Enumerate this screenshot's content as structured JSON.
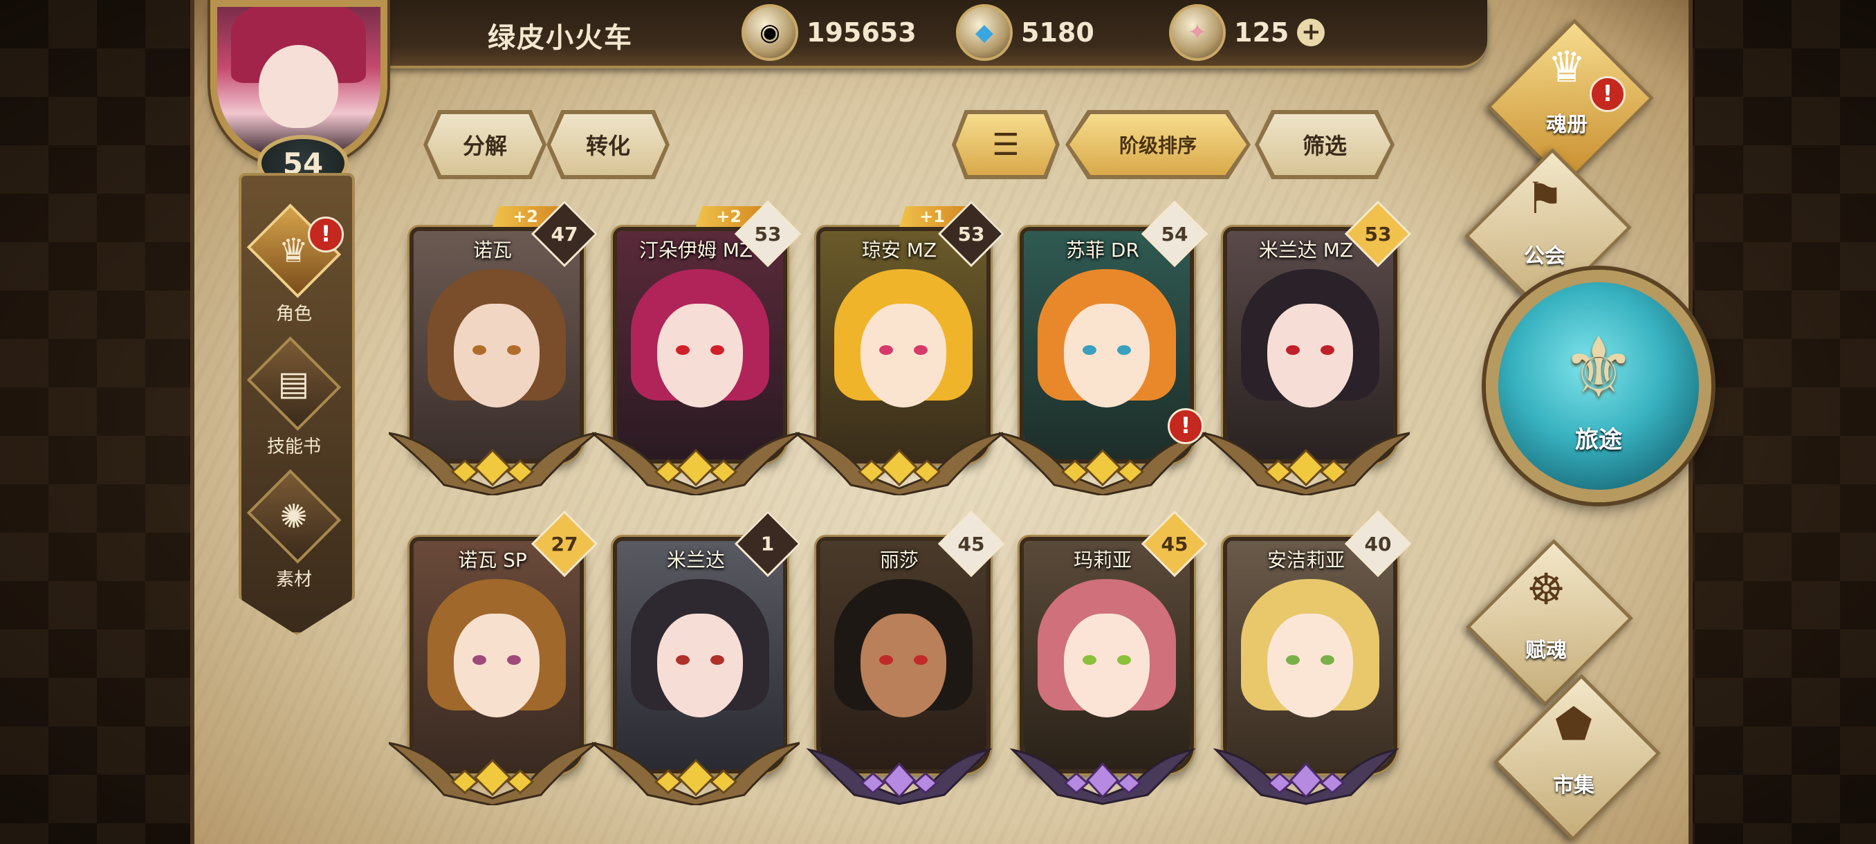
{
  "player": {
    "name": "绿皮小火车",
    "level": "54"
  },
  "currencies": [
    {
      "icon": "gold-coin-icon",
      "value": "195653"
    },
    {
      "icon": "blue-crystal-icon",
      "value": "5180"
    },
    {
      "icon": "rainbow-gem-icon",
      "value": "125",
      "plus": "+"
    }
  ],
  "actions": {
    "decompose": "分解",
    "convert": "转化",
    "rank_sort": "阶级排序",
    "filter": "筛选"
  },
  "sidebar": [
    {
      "label": "角色",
      "icon": "character-icon",
      "active": true,
      "alert": "!"
    },
    {
      "label": "技能书",
      "icon": "skill-book-icon",
      "active": false
    },
    {
      "label": "素材",
      "icon": "material-icon",
      "active": false
    }
  ],
  "right_menu": {
    "soul_book": "魂册",
    "guild": "公会",
    "journey": "旅途",
    "empower": "赋魂",
    "market": "市集",
    "alert": "!"
  },
  "cards": [
    {
      "name": "诺瓦",
      "level": "47",
      "level_style": "dark",
      "plus": "+2",
      "rarity": "gold"
    },
    {
      "name": "汀朵伊姆 MZ",
      "level": "53",
      "level_style": "white",
      "plus": "+2",
      "rarity": "gold"
    },
    {
      "name": "琼安 MZ",
      "level": "53",
      "level_style": "dark",
      "plus": "+1",
      "rarity": "gold"
    },
    {
      "name": "苏菲 DR",
      "level": "54",
      "level_style": "white",
      "plus": "",
      "rarity": "gold",
      "alert": "!"
    },
    {
      "name": "米兰达 MZ",
      "level": "53",
      "level_style": "gold",
      "plus": "",
      "rarity": "gold"
    },
    {
      "name": "诺瓦 SP",
      "level": "27",
      "level_style": "gold",
      "plus": "",
      "rarity": "gold"
    },
    {
      "name": "米兰达",
      "level": "1",
      "level_style": "dark",
      "plus": "",
      "rarity": "gold"
    },
    {
      "name": "丽莎",
      "level": "45",
      "level_style": "white",
      "plus": "",
      "rarity": "purple"
    },
    {
      "name": "玛莉亚",
      "level": "45",
      "level_style": "gold",
      "plus": "",
      "rarity": "purple"
    },
    {
      "name": "安洁莉亚",
      "level": "40",
      "level_style": "white",
      "plus": "",
      "rarity": "purple"
    }
  ]
}
